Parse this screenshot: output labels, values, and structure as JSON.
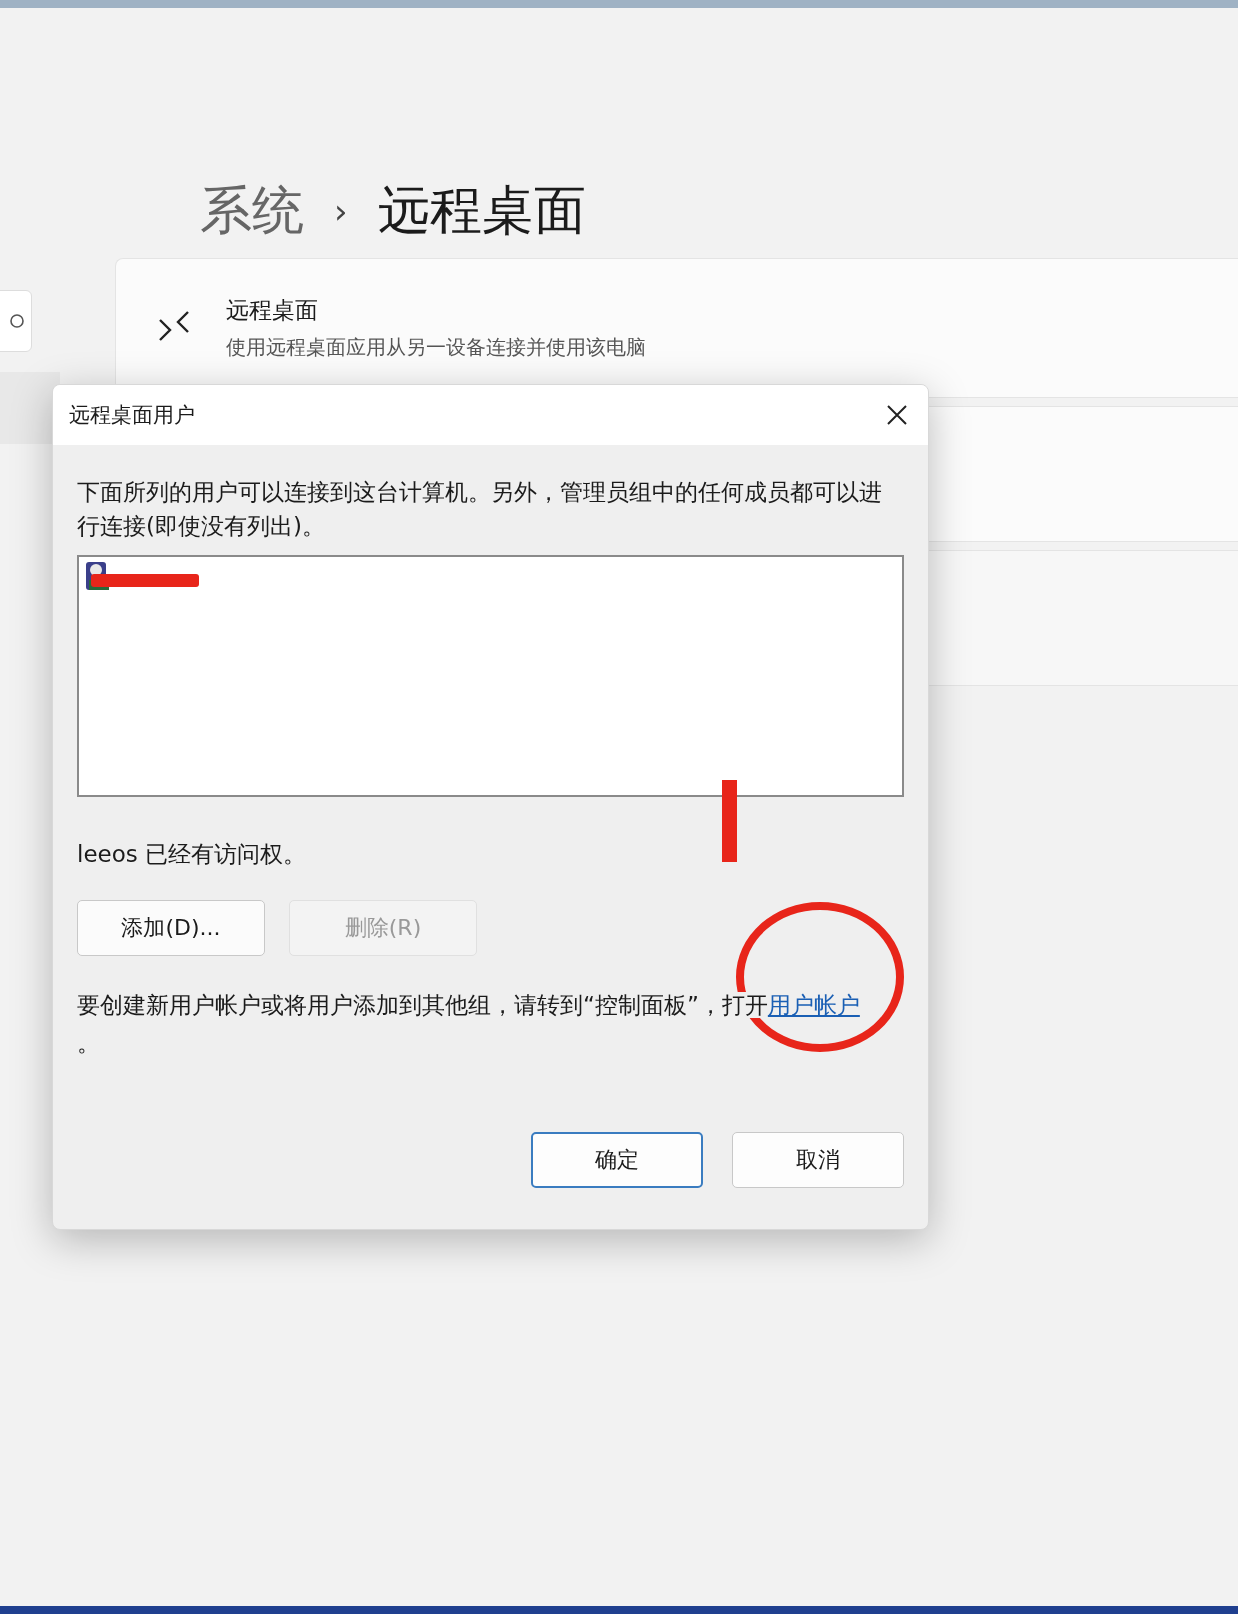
{
  "breadcrumb": {
    "parent": "系统",
    "separator": "›",
    "current": "远程桌面"
  },
  "setting_card": {
    "title": "远程桌面",
    "description": "使用远程桌面应用从另一设备连接并使用该电脑"
  },
  "dialog": {
    "title": "远程桌面用户",
    "intro": "下面所列的用户可以连接到这台计算机。另外，管理员组中的任何成员都可以进行连接(即使没有列出)。",
    "users": [
      {
        "kind": "redacted"
      }
    ],
    "access_note": "leeos 已经有访问权。",
    "buttons": [
      {
        "label": "添加(D)...",
        "disabled": false
      },
      {
        "label": "删除(R)",
        "disabled": true
      }
    ],
    "footer_text": "要创建新用户帐户或将用户添加到其他组，请转到“控制面板”，打开",
    "footer_link": "用户帐户",
    "footer_end": "。",
    "actions": [
      {
        "label": "确定",
        "default": true
      },
      {
        "label": "取消",
        "default": false
      }
    ]
  },
  "annotations": [
    {
      "kind": "bar"
    },
    {
      "kind": "circle"
    }
  ]
}
